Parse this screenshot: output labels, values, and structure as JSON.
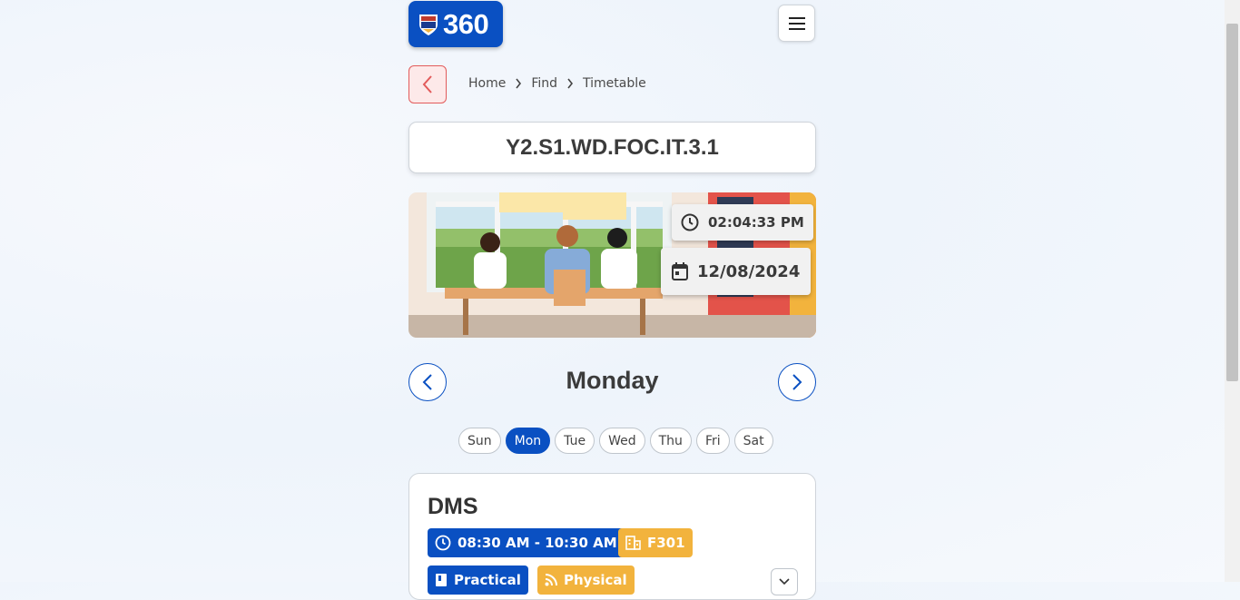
{
  "header": {
    "logo_text": "360"
  },
  "breadcrumb": {
    "items": [
      "Home",
      "Find",
      "Timetable"
    ]
  },
  "title": "Y2.S1.WD.FOC.IT.3.1",
  "banner": {
    "time": "02:04:33 PM",
    "date": "12/08/2024"
  },
  "day_nav": {
    "current_day": "Monday",
    "days": [
      "Sun",
      "Mon",
      "Tue",
      "Wed",
      "Thu",
      "Fri",
      "Sat"
    ],
    "active_index": 1
  },
  "classes": [
    {
      "name": "DMS",
      "time": "08:30 AM - 10:30 AM",
      "room": "F301",
      "type": "Practical",
      "mode": "Physical"
    }
  ],
  "colors": {
    "primary": "#0a50c2",
    "accent": "#f2b33d",
    "back_red": "#e25b5b"
  }
}
